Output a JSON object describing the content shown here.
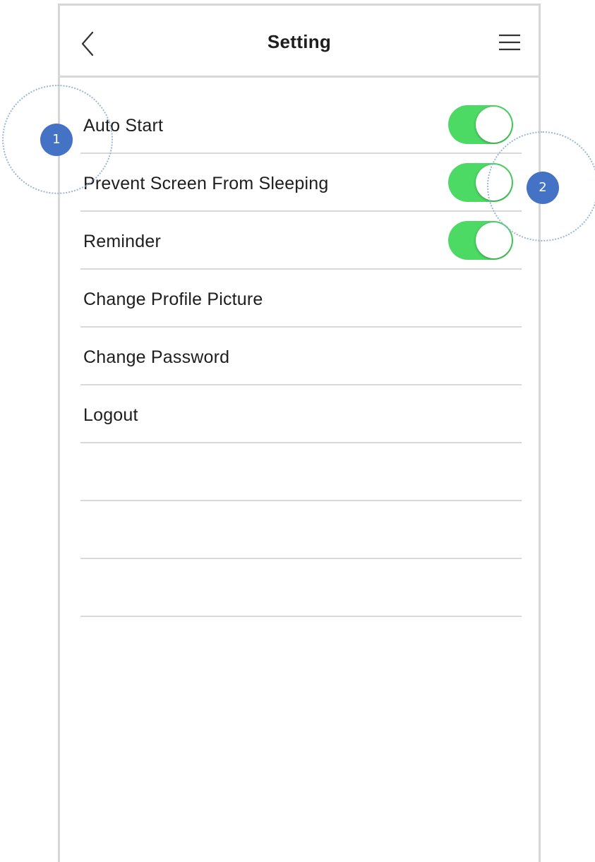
{
  "header": {
    "title": "Setting",
    "back_icon": "chevron-left-icon",
    "menu_icon": "hamburger-menu-icon"
  },
  "settings": {
    "items": [
      {
        "label": "Auto Start",
        "has_toggle": true,
        "toggle_on": true
      },
      {
        "label": "Prevent Screen From Sleeping",
        "has_toggle": true,
        "toggle_on": true
      },
      {
        "label": "Reminder",
        "has_toggle": true,
        "toggle_on": true
      },
      {
        "label": "Change Profile Picture",
        "has_toggle": false
      },
      {
        "label": "Change Password",
        "has_toggle": false
      },
      {
        "label": "Logout",
        "has_toggle": false
      },
      {
        "label": "",
        "has_toggle": false
      },
      {
        "label": "",
        "has_toggle": false
      },
      {
        "label": "",
        "has_toggle": false
      }
    ]
  },
  "annotations": {
    "badge_1": "1",
    "badge_2": "2"
  },
  "colors": {
    "toggle_on": "#4cd964",
    "annotation_badge": "#4472c4",
    "divider": "#d9d9d9"
  }
}
